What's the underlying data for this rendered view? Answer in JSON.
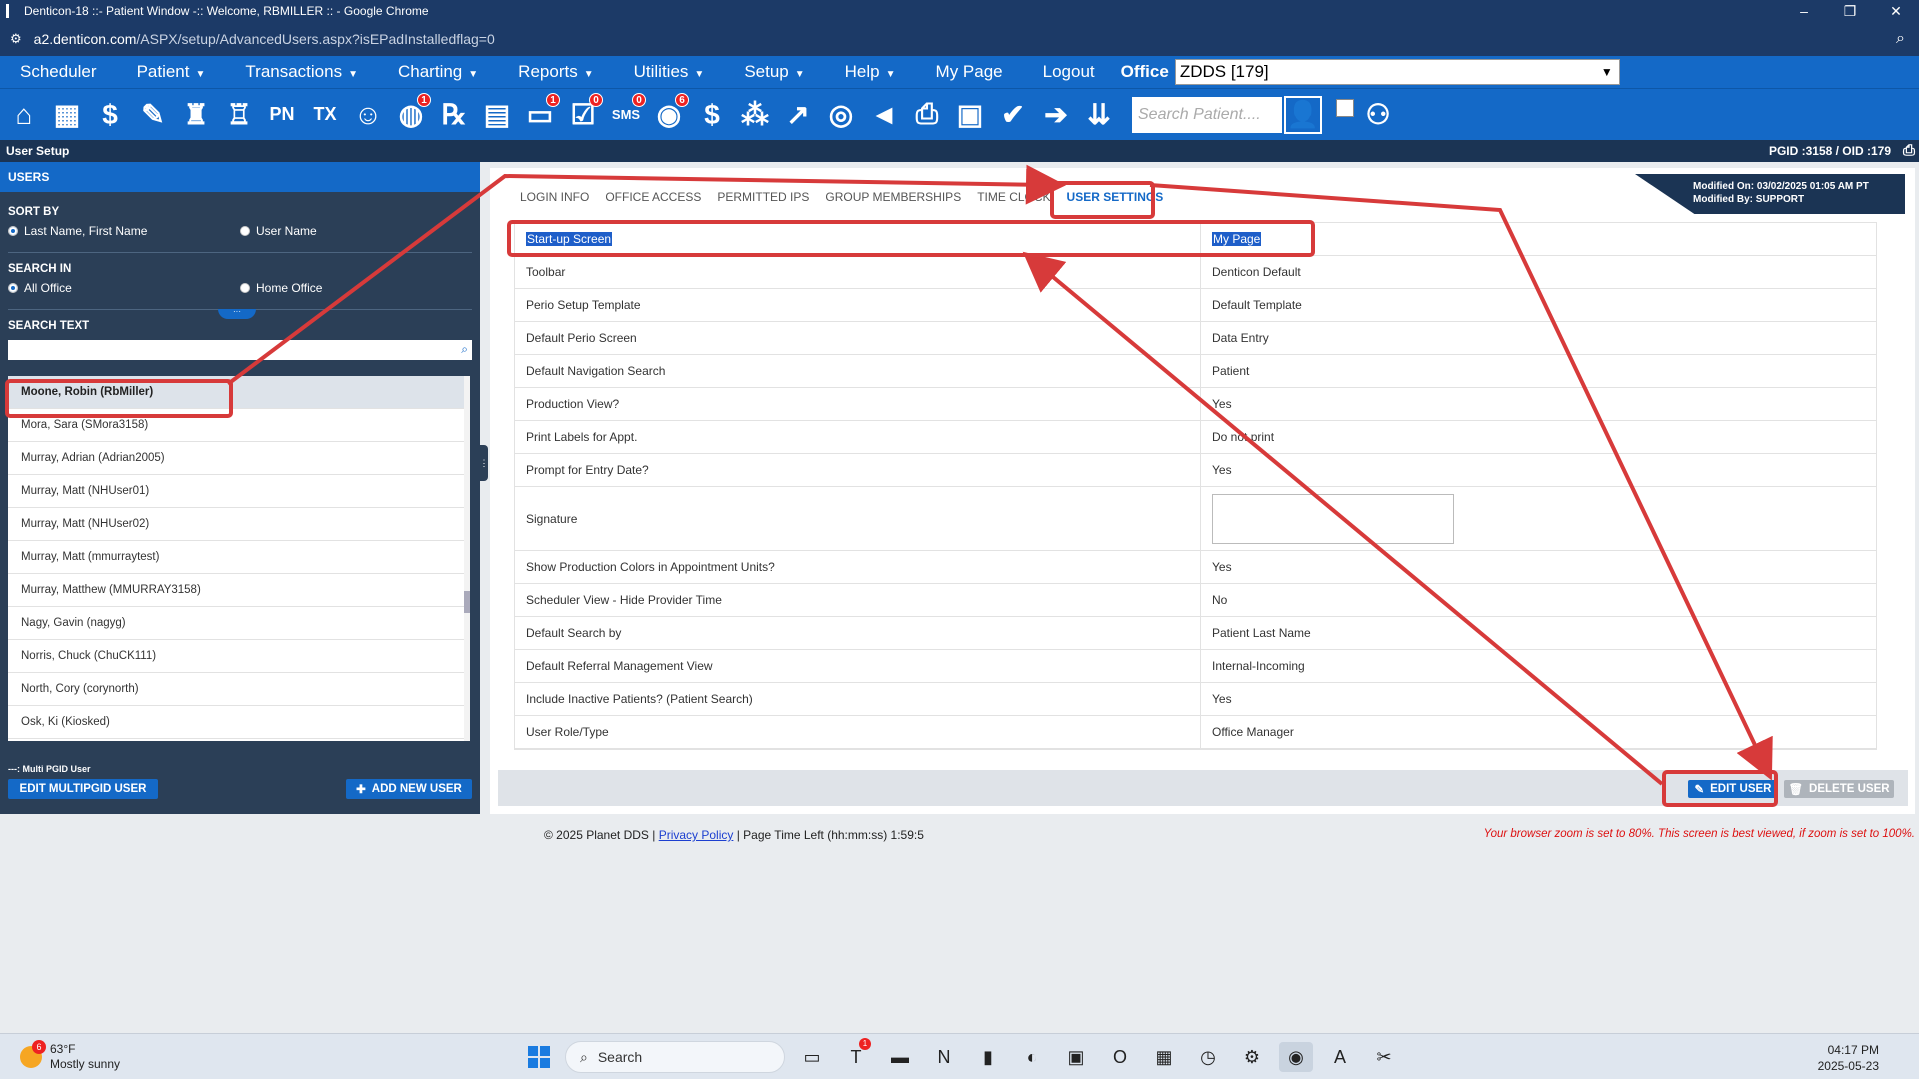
{
  "window": {
    "title": "Denticon-18 ::- Patient Window -:: Welcome, RBMILLER :: - Google Chrome",
    "url_host": "a2.denticon.com",
    "url_path": "/ASPX/setup/AdvancedUsers.aspx?isEPadInstalledflag=0",
    "controls": [
      "–",
      "❐",
      "✕"
    ]
  },
  "menu": {
    "items": [
      {
        "label": "Scheduler",
        "caret": false
      },
      {
        "label": "Patient",
        "caret": true
      },
      {
        "label": "Transactions",
        "caret": true
      },
      {
        "label": "Charting",
        "caret": true
      },
      {
        "label": "Reports",
        "caret": true
      },
      {
        "label": "Utilities",
        "caret": true
      },
      {
        "label": "Setup",
        "caret": true
      },
      {
        "label": "Help",
        "caret": true
      },
      {
        "label": "My Page",
        "caret": false
      },
      {
        "label": "Logout",
        "caret": false
      }
    ],
    "office_label": "Office",
    "office_value": "ZDDS [179]"
  },
  "toolbar": {
    "icons": [
      {
        "name": "home-icon",
        "glyph": "⌂"
      },
      {
        "name": "calendar-icon",
        "glyph": "▦"
      },
      {
        "name": "dollar-icon",
        "glyph": "$"
      },
      {
        "name": "edit-note-icon",
        "glyph": "✎"
      },
      {
        "name": "tooth-chart-icon",
        "glyph": "♜"
      },
      {
        "name": "perio-icon",
        "glyph": "♖"
      },
      {
        "name": "pn-icon",
        "glyph": "PN"
      },
      {
        "name": "tx-icon",
        "glyph": "TX"
      },
      {
        "name": "add-patient-icon",
        "glyph": "☺"
      },
      {
        "name": "globe-icon",
        "glyph": "◍",
        "badge": "1"
      },
      {
        "name": "rx-icon",
        "glyph": "℞"
      },
      {
        "name": "message-icon",
        "glyph": "▤"
      },
      {
        "name": "chat-icon",
        "glyph": "▭",
        "badge": "1"
      },
      {
        "name": "task-icon",
        "glyph": "☑",
        "badge": "0"
      },
      {
        "name": "sms-icon",
        "glyph": "SMS",
        "badge": "0"
      },
      {
        "name": "support-icon",
        "glyph": "◉",
        "badge": "6"
      },
      {
        "name": "insurance-icon",
        "glyph": "$"
      },
      {
        "name": "network-icon",
        "glyph": "⁂"
      },
      {
        "name": "chart-line-icon",
        "glyph": "↗"
      },
      {
        "name": "group-icon",
        "glyph": "◎"
      },
      {
        "name": "megaphone-icon",
        "glyph": "◄"
      },
      {
        "name": "print-icon",
        "glyph": "⎙"
      },
      {
        "name": "scanner-icon",
        "glyph": "▣"
      },
      {
        "name": "shield-check-icon",
        "glyph": "✔"
      },
      {
        "name": "shield-arrow-icon",
        "glyph": "➔"
      },
      {
        "name": "shield-down-icon",
        "glyph": "⇊"
      }
    ],
    "search_placeholder": "Search Patient...."
  },
  "page": {
    "title": "User Setup",
    "pgid": "PGID :3158  /  OID :179"
  },
  "left": {
    "title": "USERS",
    "sort_by": "SORT BY",
    "sort_options": [
      "Last Name, First Name",
      "User Name"
    ],
    "search_in": "SEARCH IN",
    "search_options": [
      "All Office",
      "Home Office"
    ],
    "search_text": "SEARCH TEXT",
    "users": [
      "Moone, Robin (RbMiller)",
      "Mora, Sara (SMora3158)",
      "Murray, Adrian (Adrian2005)",
      "Murray, Matt (NHUser01)",
      "Murray, Matt (NHUser02)",
      "Murray, Matt (mmurraytest)",
      "Murray, Matthew (MMURRAY3158)",
      "Nagy, Gavin (nagyg)",
      "Norris, Chuck (ChuCK111)",
      "North, Cory (corynorth)",
      "Osk, Ki (Kiosked)"
    ],
    "multi_note": "---: Multi PGID User",
    "edit_multi": "EDIT MULTIPGID USER",
    "add_user": "ADD NEW USER"
  },
  "main": {
    "modified_on": "Modified On: 03/02/2025 01:05 AM PT",
    "modified_by": "Modified By: SUPPORT",
    "tabs": [
      "LOGIN INFO",
      "OFFICE ACCESS",
      "PERMITTED IPS",
      "GROUP MEMBERSHIPS",
      "TIME CLOCK",
      "USER SETTINGS"
    ],
    "settings": [
      {
        "k": "Start-up Screen",
        "v": "My Page"
      },
      {
        "k": "Toolbar",
        "v": "Denticon Default"
      },
      {
        "k": "Perio Setup Template",
        "v": "Default Template"
      },
      {
        "k": "Default Perio Screen",
        "v": "Data Entry"
      },
      {
        "k": "Default Navigation Search",
        "v": "Patient"
      },
      {
        "k": "Production View?",
        "v": "Yes"
      },
      {
        "k": "Print Labels for Appt.",
        "v": "Do not print"
      },
      {
        "k": "Prompt for Entry Date?",
        "v": "Yes"
      },
      {
        "k": "Signature",
        "v": ""
      },
      {
        "k": "Show Production Colors in Appointment Units?",
        "v": "Yes"
      },
      {
        "k": "Scheduler View - Hide Provider Time",
        "v": "No"
      },
      {
        "k": "Default Search by",
        "v": "Patient Last Name"
      },
      {
        "k": "Default Referral Management View",
        "v": "Internal-Incoming"
      },
      {
        "k": "Include Inactive Patients? (Patient Search)",
        "v": "Yes"
      },
      {
        "k": "User Role/Type",
        "v": "Office Manager"
      }
    ],
    "edit_user": "EDIT USER",
    "delete_user": "DELETE USER"
  },
  "footer": {
    "copyright": "© 2025 Planet DDS | ",
    "privacy": "Privacy Policy",
    "time_left": " |  Page Time Left (hh:mm:ss) 1:59:5",
    "zoom_warning": "Your browser zoom is set to 80%. This screen is best viewed, if zoom is set to 100%."
  },
  "taskbar": {
    "temp": "63°F",
    "condition": "Mostly sunny",
    "weather_badge": "6",
    "search": "Search",
    "time": "04:17 PM",
    "date": "2025-05-23",
    "apps": [
      {
        "name": "task-view-icon",
        "glyph": "▭"
      },
      {
        "name": "teams-icon",
        "glyph": "T",
        "badge": "1"
      },
      {
        "name": "file-explorer-icon",
        "glyph": "▬"
      },
      {
        "name": "onenote-icon",
        "glyph": "N"
      },
      {
        "name": "sticky-notes-icon",
        "glyph": "▮"
      },
      {
        "name": "edge-icon",
        "glyph": "◐"
      },
      {
        "name": "store-icon",
        "glyph": "▣"
      },
      {
        "name": "outlook-icon",
        "glyph": "O"
      },
      {
        "name": "calculator-icon",
        "glyph": "▦"
      },
      {
        "name": "clock-app-icon",
        "glyph": "◷"
      },
      {
        "name": "settings-icon",
        "glyph": "⚙"
      },
      {
        "name": "chrome-icon",
        "glyph": "◉",
        "active": true
      },
      {
        "name": "acrobat-icon",
        "glyph": "A"
      },
      {
        "name": "snipping-tool-icon",
        "glyph": "✂"
      }
    ]
  },
  "colors": {
    "brand_blue": "#1469c7",
    "dark_navy": "#1b3454",
    "annotation_red": "#d73a3a"
  }
}
